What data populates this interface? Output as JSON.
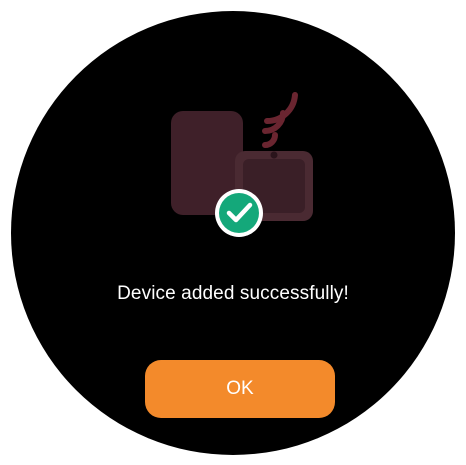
{
  "dialog": {
    "message": "Device added successfully!",
    "ok_label": "OK",
    "status_icon": "success-check-icon",
    "illustration_icon": "devices-wireless-icon"
  },
  "colors": {
    "background": "#000000",
    "accent": "#f38a2b",
    "success": "#14a87a",
    "device": "#4a2a32",
    "signal": "#6a2530"
  }
}
